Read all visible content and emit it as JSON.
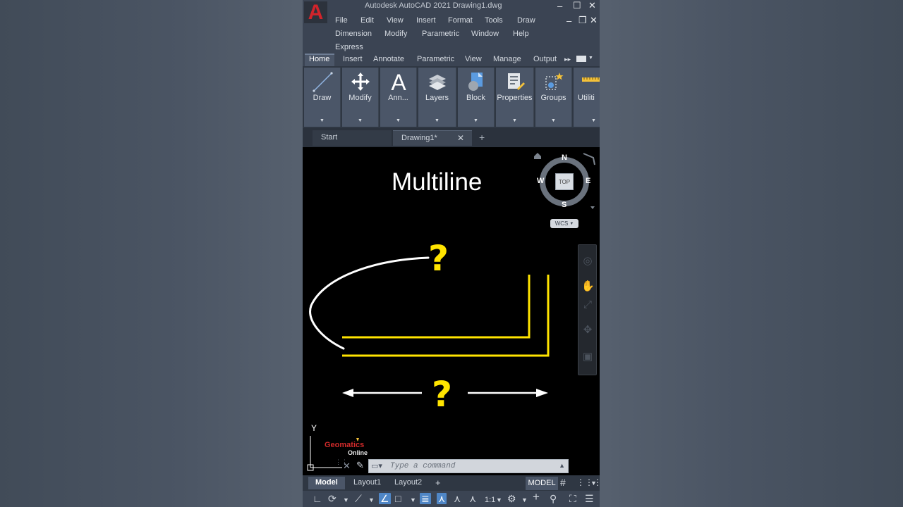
{
  "app": {
    "logo_letter": "A",
    "title": "Autodesk AutoCAD 2021    Drawing1.dwg",
    "window_controls": {
      "minimize": "–",
      "maximize": "☐",
      "close": "✕",
      "doc_minimize": "–",
      "doc_restore": "❐",
      "doc_close": "✕"
    }
  },
  "menu": {
    "file": "File",
    "edit": "Edit",
    "view": "View",
    "insert": "Insert",
    "format": "Format",
    "tools": "Tools",
    "draw": "Draw",
    "dimension": "Dimension",
    "modify": "Modify",
    "parametric": "Parametric",
    "window": "Window",
    "help": "Help",
    "express": "Express"
  },
  "ribbon": {
    "tabs": [
      "Home",
      "Insert",
      "Annotate",
      "Parametric",
      "View",
      "Manage",
      "Output"
    ],
    "overflow": "▸▸",
    "panels": [
      "Draw",
      "Modify",
      "Ann...",
      "Layers",
      "Block",
      "Properties",
      "Groups",
      "Utiliti"
    ]
  },
  "doc_tabs": {
    "start": "Start",
    "drawing": "Drawing1*",
    "close": "✕",
    "new": "+"
  },
  "drawing": {
    "title": "Multiline",
    "question_mark": "?",
    "compass": {
      "n": "N",
      "s": "S",
      "e": "E",
      "w": "W",
      "top": "TOP"
    },
    "wcs": "WCS",
    "ucs_y": "Y",
    "watermark_line1": "Geomatics",
    "watermark_line2": "Online",
    "colors": {
      "yellow": "#ffe400",
      "white": "#ffffff",
      "background": "#000000"
    }
  },
  "command_line": {
    "placeholder": "Type a command",
    "close": "✕",
    "expand": "▲"
  },
  "layout_tabs": {
    "model": "Model",
    "layout1": "Layout1",
    "layout2": "Layout2",
    "add": "+"
  },
  "status_bar": {
    "model": "MODEL",
    "scale": "1:1"
  }
}
